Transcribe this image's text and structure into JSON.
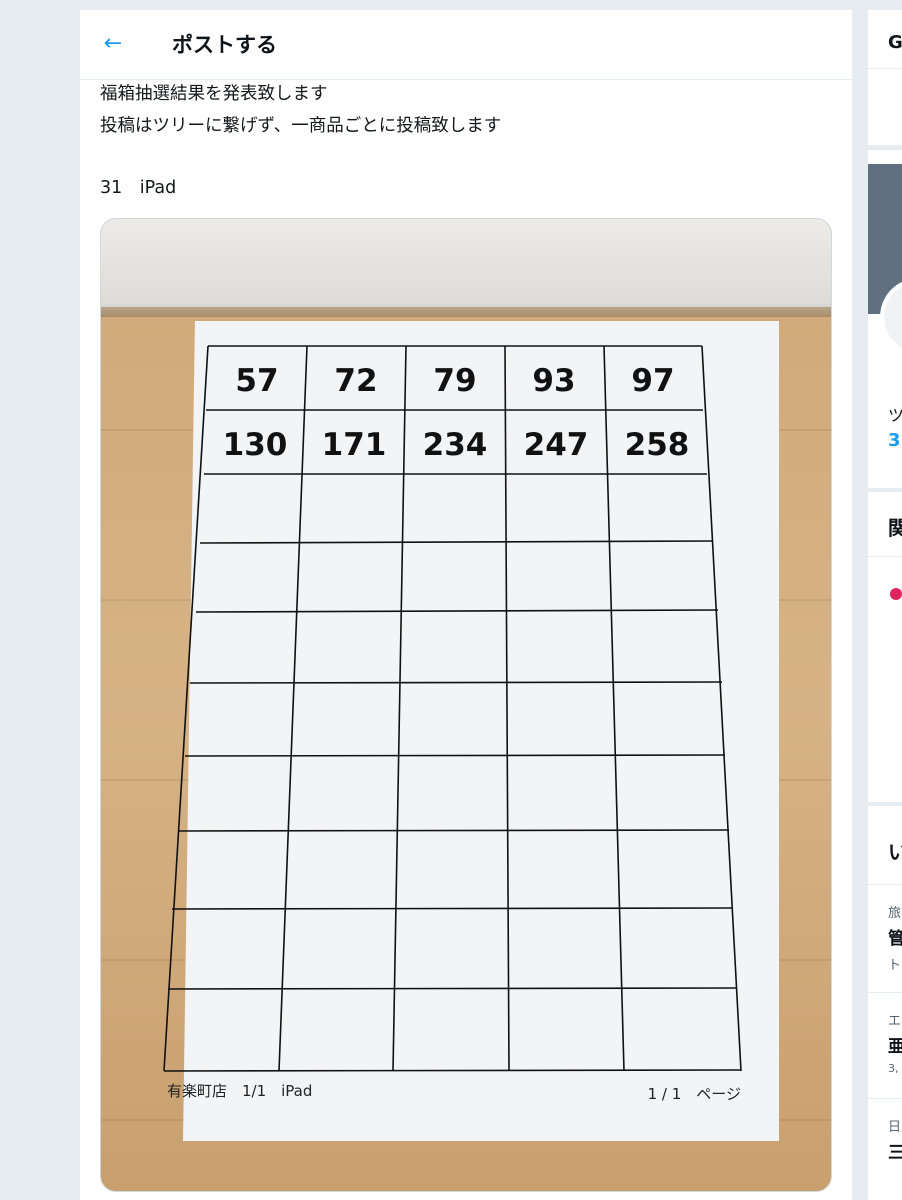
{
  "header": {
    "back_icon": "arrow-left-icon",
    "title": "ポストする"
  },
  "post": {
    "lines": [
      "福箱抽選結果を発表致します",
      "投稿はツリーに繋げず、一商品ごとに投稿致します",
      "31　iPad"
    ]
  },
  "photo": {
    "numbers_row1": [
      "57",
      "72",
      "79",
      "93",
      "97"
    ],
    "numbers_row2": [
      "130",
      "171",
      "234",
      "247",
      "258"
    ],
    "footer_left": "有楽町店　1/1　iPad",
    "footer_right": "1 / 1　ページ"
  },
  "sidebar": {
    "box1_letter": "G",
    "box3_lines": [
      "ツ",
      "3"
    ],
    "box4_letter": "関",
    "box5_letter": "い",
    "trend_items": [
      {
        "category": "旅",
        "title": "管",
        "meta": "ト"
      },
      {
        "category": "エ",
        "title": "亜",
        "meta": "3,"
      },
      {
        "category": "日",
        "title": "三",
        "meta": ""
      }
    ]
  }
}
